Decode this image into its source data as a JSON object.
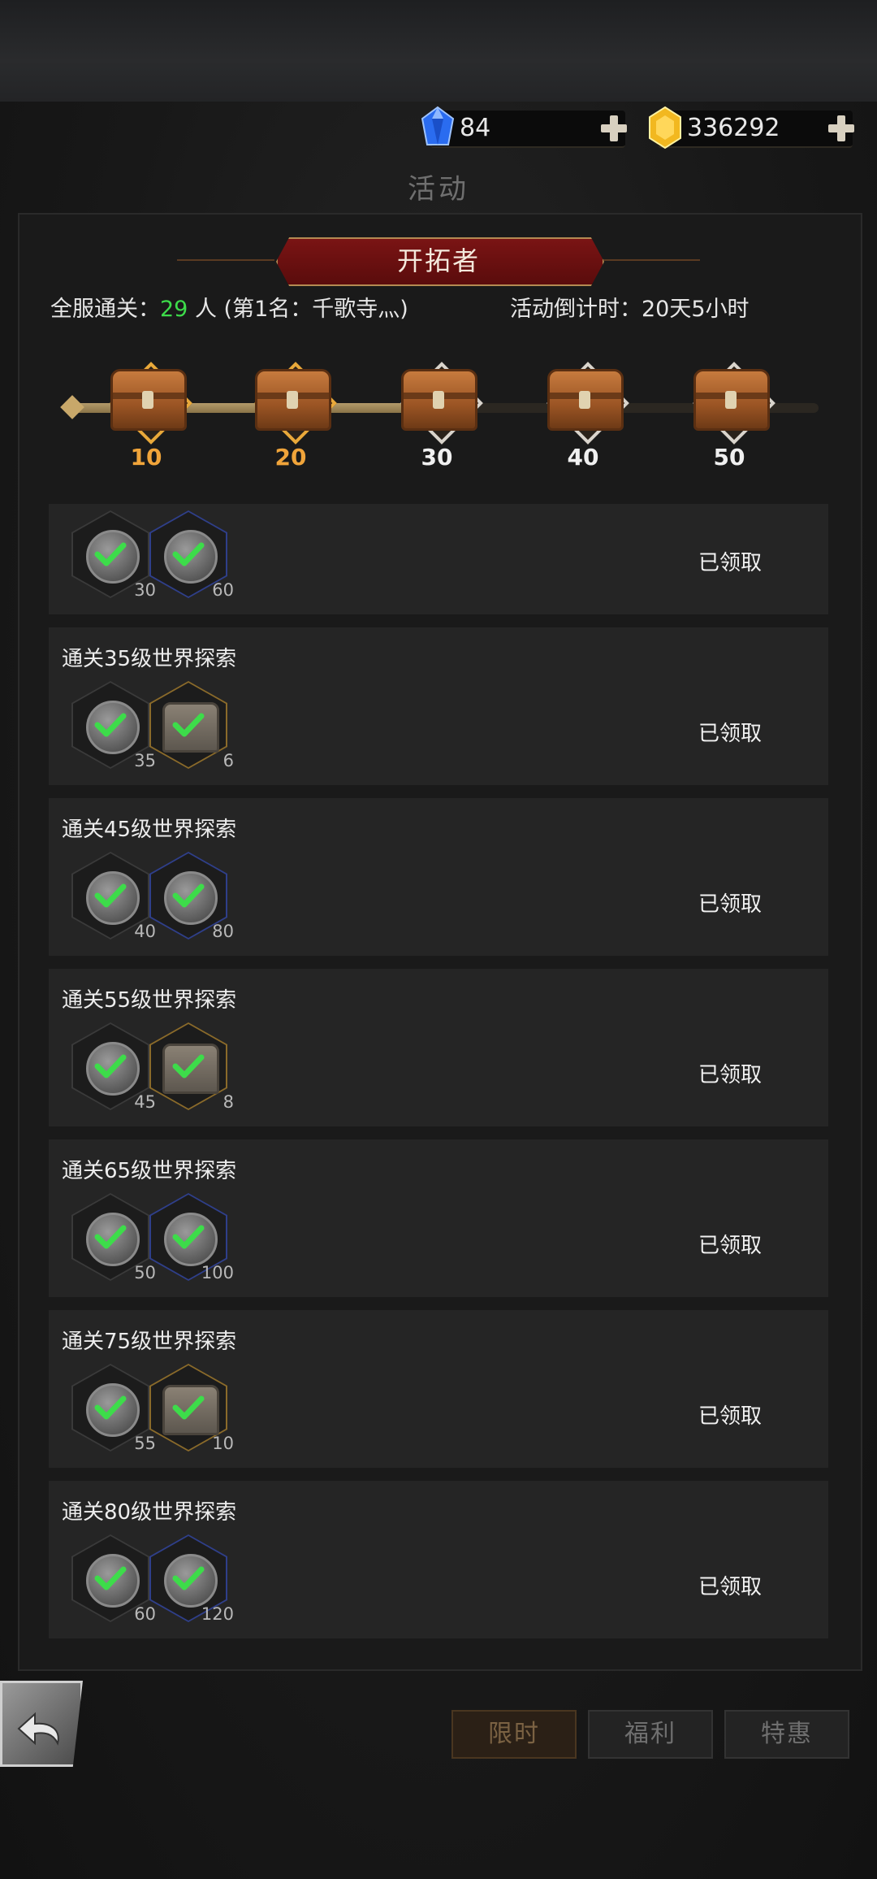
{
  "header": {
    "gems": "84",
    "gold": "336292",
    "page_title": "活动"
  },
  "event": {
    "banner_title": "开拓者",
    "stats_prefix": "全服通关：",
    "clear_count": "29",
    "stats_suffix": "人 (第1名：千歌寺灬)",
    "countdown": "活动倒计时：20天5小时"
  },
  "milestones": [
    {
      "label": "10",
      "state": "claimed"
    },
    {
      "label": "20",
      "state": "claimed"
    },
    {
      "label": "30",
      "state": "locked"
    },
    {
      "label": "40",
      "state": "locked"
    },
    {
      "label": "50",
      "state": "locked"
    }
  ],
  "progress_fraction": 0.52,
  "rows": [
    {
      "title": "",
      "rewards": [
        {
          "qty": "30",
          "kind": "coin",
          "frame": "gray"
        },
        {
          "qty": "60",
          "kind": "coin",
          "frame": "blue"
        }
      ],
      "status": "已领取"
    },
    {
      "title": "通关35级世界探索",
      "rewards": [
        {
          "qty": "35",
          "kind": "coin",
          "frame": "gray"
        },
        {
          "qty": "6",
          "kind": "box",
          "frame": "gold"
        }
      ],
      "status": "已领取"
    },
    {
      "title": "通关45级世界探索",
      "rewards": [
        {
          "qty": "40",
          "kind": "coin",
          "frame": "gray"
        },
        {
          "qty": "80",
          "kind": "coin",
          "frame": "blue"
        }
      ],
      "status": "已领取"
    },
    {
      "title": "通关55级世界探索",
      "rewards": [
        {
          "qty": "45",
          "kind": "coin",
          "frame": "gray"
        },
        {
          "qty": "8",
          "kind": "box",
          "frame": "gold"
        }
      ],
      "status": "已领取"
    },
    {
      "title": "通关65级世界探索",
      "rewards": [
        {
          "qty": "50",
          "kind": "coin",
          "frame": "gray"
        },
        {
          "qty": "100",
          "kind": "coin",
          "frame": "blue"
        }
      ],
      "status": "已领取"
    },
    {
      "title": "通关75级世界探索",
      "rewards": [
        {
          "qty": "55",
          "kind": "coin",
          "frame": "gray"
        },
        {
          "qty": "10",
          "kind": "box",
          "frame": "gold"
        }
      ],
      "status": "已领取"
    },
    {
      "title": "通关80级世界探索",
      "rewards": [
        {
          "qty": "60",
          "kind": "coin",
          "frame": "gray"
        },
        {
          "qty": "120",
          "kind": "coin",
          "frame": "blue"
        }
      ],
      "status": "已领取"
    }
  ],
  "tabs": [
    {
      "label": "限时",
      "active": true
    },
    {
      "label": "福利",
      "active": false
    },
    {
      "label": "特惠",
      "active": false
    }
  ],
  "colors": {
    "accent_green": "#3ddc4a",
    "banner_red": "#7a1414",
    "milestone_gold": "#f0a43a"
  },
  "icons": [
    "gem-icon",
    "gold-icon",
    "plus-icon",
    "chest-icon",
    "coin-icon",
    "check-icon",
    "back-arrow-icon"
  ]
}
